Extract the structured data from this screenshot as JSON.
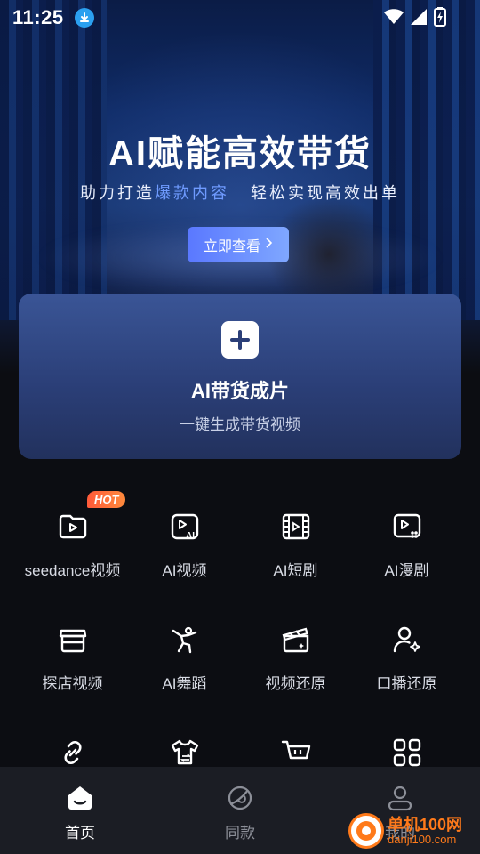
{
  "status": {
    "time": "11:25"
  },
  "hero": {
    "title": "AI赋能高效带货",
    "subtitle_part1": "助力打造",
    "subtitle_highlight": "爆款内容",
    "subtitle_part2": "轻松实现高效出单",
    "button_label": "立即查看",
    "button_arrow": ">"
  },
  "main_card": {
    "title": "AI带货成片",
    "subtitle": "一键生成带货视频"
  },
  "hot_badge": "HOT",
  "grid": {
    "items": [
      {
        "label": "seedance视频",
        "icon": "folder-play-icon"
      },
      {
        "label": "AI视频",
        "icon": "ai-video-icon"
      },
      {
        "label": "AI短剧",
        "icon": "film-strip-icon"
      },
      {
        "label": "AI漫剧",
        "icon": "comic-video-icon"
      },
      {
        "label": "探店视频",
        "icon": "store-icon"
      },
      {
        "label": "AI舞蹈",
        "icon": "dancer-icon"
      },
      {
        "label": "视频还原",
        "icon": "clapperboard-icon"
      },
      {
        "label": "口播还原",
        "icon": "user-voice-icon"
      },
      {
        "label": "",
        "icon": "link-icon"
      },
      {
        "label": "",
        "icon": "shirt-swap-icon"
      },
      {
        "label": "",
        "icon": "cart-icon"
      },
      {
        "label": "",
        "icon": "grid-more-icon"
      }
    ]
  },
  "nav": {
    "items": [
      {
        "label": "首页",
        "icon": "home-icon"
      },
      {
        "label": "同款",
        "icon": "planet-icon"
      },
      {
        "label": "我的",
        "icon": "profile-icon"
      }
    ]
  },
  "watermark": {
    "cn": "单机100网",
    "en": "danji100.com"
  },
  "colors": {
    "accent": "#6f9bff",
    "hot": "#ff5a3a",
    "card": "#2b3f78",
    "navbg": "#1b1d24"
  }
}
